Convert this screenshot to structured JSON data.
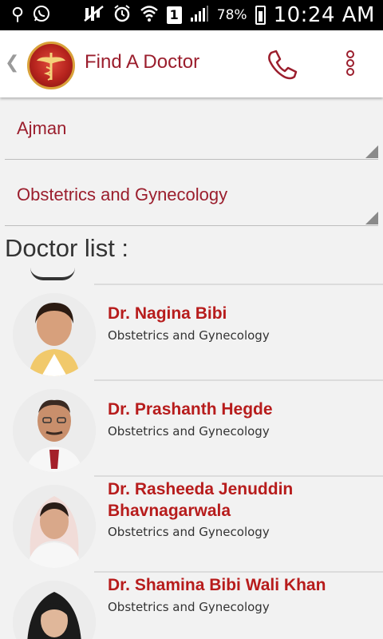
{
  "status_bar": {
    "battery_percent": "78%",
    "time": "10:24 AM",
    "sim_slot": "1",
    "icons": [
      "usb-icon",
      "whatsapp-icon",
      "mute-icon",
      "alarm-icon",
      "wifi-icon",
      "signal-icon",
      "battery-charging-icon"
    ]
  },
  "header": {
    "title": "Find A Doctor",
    "icons": [
      "back-chevron-icon",
      "logo-icon",
      "phone-icon",
      "more-vertical-icon"
    ]
  },
  "filters": {
    "location": "Ajman",
    "specialty": "Obstetrics and Gynecology"
  },
  "section_title": "Doctor list :",
  "doctors": [
    {
      "name": "Dr. Nagina Bibi",
      "specialty": "Obstetrics and Gynecology"
    },
    {
      "name": "Dr. Prashanth Hegde",
      "specialty": "Obstetrics and Gynecology"
    },
    {
      "name": "Dr. Rasheeda Jenuddin Bhavnagarwala",
      "specialty": "Obstetrics and Gynecology"
    },
    {
      "name": "Dr. Shamina Bibi Wali Khan",
      "specialty": "Obstetrics and Gynecology"
    }
  ],
  "colors": {
    "brand": "#9b1e2d",
    "doctor_name": "#b71c1c",
    "background": "#f2f2f2"
  }
}
